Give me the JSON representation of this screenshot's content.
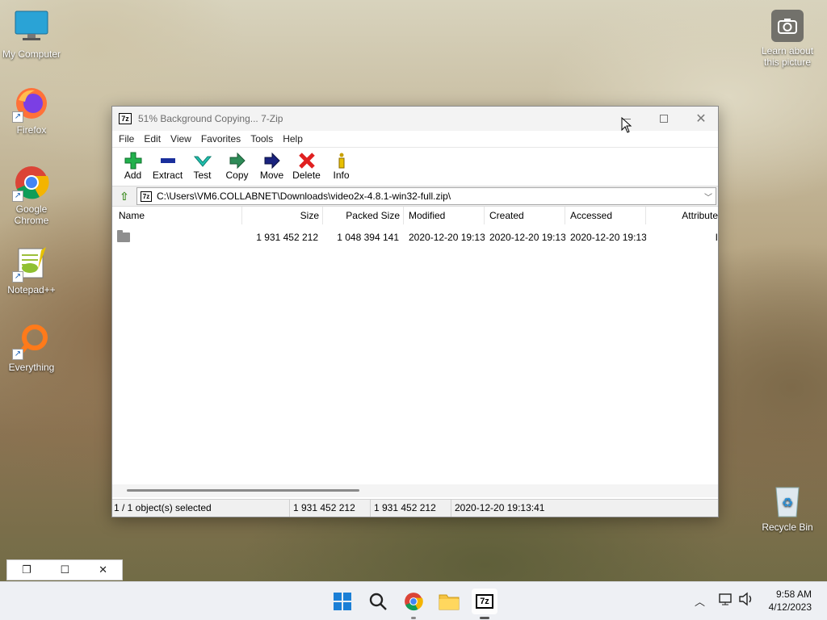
{
  "desktop": {
    "icons_left": [
      {
        "label": "My Computer",
        "icon": "monitor-icon"
      },
      {
        "label": "Firefox",
        "icon": "firefox-icon"
      },
      {
        "label": "Google Chrome",
        "icon": "chrome-icon"
      },
      {
        "label": "Notepad++",
        "icon": "notepadpp-icon"
      },
      {
        "label": "Everything",
        "icon": "everything-search-icon"
      }
    ],
    "learn_picture": {
      "label": "Learn about this picture",
      "icon": "camera-icon"
    },
    "recycle_bin": {
      "label": "Recycle Bin",
      "icon": "recycle-bin-icon"
    }
  },
  "window": {
    "title": "51% Background Copying... 7-Zip",
    "app_icon_text": "7z",
    "menu": [
      "File",
      "Edit",
      "View",
      "Favorites",
      "Tools",
      "Help"
    ],
    "toolbar": [
      {
        "label": "Add",
        "icon": "plus-icon",
        "color": "#22b14c"
      },
      {
        "label": "Extract",
        "icon": "minus-icon",
        "color": "#1a2f9c"
      },
      {
        "label": "Test",
        "icon": "check-icon",
        "color": "#20b2aa"
      },
      {
        "label": "Copy",
        "icon": "copy-arrow-icon",
        "color": "#2e8b57"
      },
      {
        "label": "Move",
        "icon": "move-arrow-icon",
        "color": "#1a237e"
      },
      {
        "label": "Delete",
        "icon": "delete-x-icon",
        "color": "#e02020"
      },
      {
        "label": "Info",
        "icon": "info-icon",
        "color": "#c8a000"
      }
    ],
    "address": "C:\\Users\\VM6.COLLABNET\\Downloads\\video2x-4.8.1-win32-full.zip\\",
    "columns": [
      "Name",
      "Size",
      "Packed Size",
      "Modified",
      "Created",
      "Accessed",
      "Attribute"
    ],
    "rows": [
      {
        "name": "",
        "size": "1 931 452 212",
        "packed": "1 048 394 141",
        "modified": "2020-12-20 19:13",
        "created": "2020-12-20 19:13",
        "accessed": "2020-12-20 19:13",
        "attributes": "I"
      }
    ],
    "status": {
      "selection": "1 / 1 object(s) selected",
      "size": "1 931 452 212",
      "packed": "1 931 452 212",
      "modified": "2020-12-20 19:13:41"
    }
  },
  "taskbar": {
    "apps": [
      "start-icon",
      "search-icon",
      "chrome-icon",
      "file-explorer-icon",
      "7zip-icon"
    ],
    "clock_time": "9:58 AM",
    "clock_date": "4/12/2023"
  }
}
